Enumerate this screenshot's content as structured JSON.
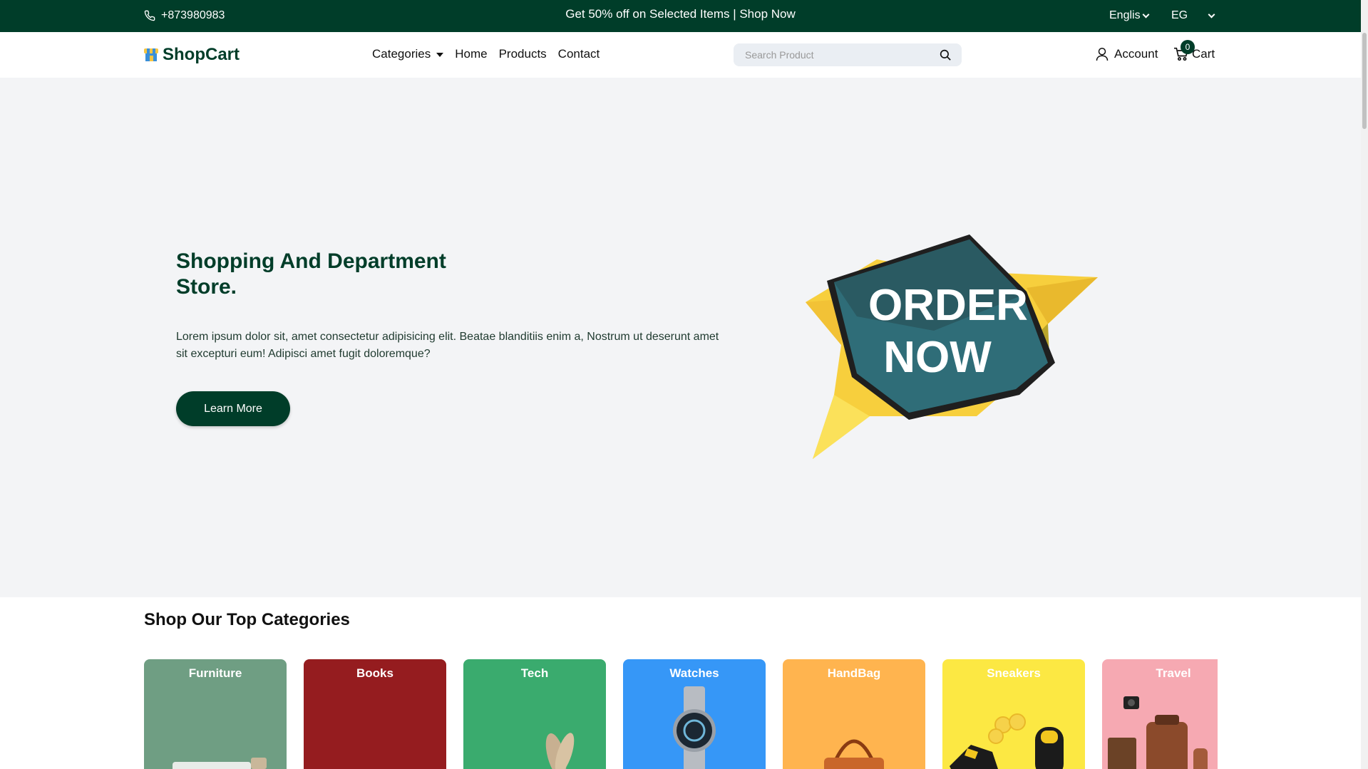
{
  "topbar": {
    "phone": "+873980983",
    "promo": "Get 50% off on Selected Items | Shop Now",
    "language": "Englis",
    "region": "EG"
  },
  "nav": {
    "logo": "ShopCart",
    "menu": [
      {
        "label": "Categories"
      },
      {
        "label": "Home"
      },
      {
        "label": "Products"
      },
      {
        "label": "Contact"
      }
    ],
    "search_placeholder": "Search Product",
    "account": "Account",
    "cart": "Cart",
    "cart_count": "0"
  },
  "hero": {
    "title": "Shopping And Department Store.",
    "description": "Lorem ipsum dolor sit, amet consectetur adipisicing elit. Beatae blanditiis enim a, Nostrum ut deserunt amet sit excepturi eum! Adipisci amet fugit doloremque?",
    "button": "Learn More",
    "graphic_line1": "ORDER",
    "graphic_line2": "NOW"
  },
  "categories": {
    "title": "Shop Our Top Categories",
    "items": [
      {
        "label": "Furniture",
        "color": "#6f9e83"
      },
      {
        "label": "Books",
        "color": "#951c1f"
      },
      {
        "label": "Tech",
        "color": "#3aab6e"
      },
      {
        "label": "Watches",
        "color": "#3697f7"
      },
      {
        "label": "HandBag",
        "color": "#ffb44f"
      },
      {
        "label": "Sneakers",
        "color": "#fce843"
      },
      {
        "label": "Travel",
        "color": "#f6a9b2"
      }
    ]
  }
}
